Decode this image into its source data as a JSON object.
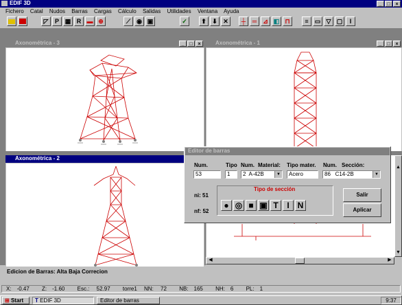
{
  "app": {
    "title": "EDIF 3D",
    "menu": [
      "Fichero",
      "Catal",
      "Nudos",
      "Barras",
      "Cargas",
      "Cálculo",
      "Salidas",
      "Utilidades",
      "Ventana",
      "Ayuda"
    ]
  },
  "toolbar": {
    "p_label": "P",
    "r_label": "R",
    "check_label": "✓"
  },
  "windows": {
    "view3": "Axonométrica - 3",
    "view1": "Axonométrica - 1",
    "view2": "Axonométrica - 2"
  },
  "dialog": {
    "title": "Editor de barras",
    "headers": {
      "num": "Num.",
      "tipo": "Tipo",
      "num2": "Num.",
      "material": "Material:",
      "tipo_mater": "Tipo mater.",
      "num3": "Num.",
      "seccion": "Sección:"
    },
    "values": {
      "num": "53",
      "tipo": "1",
      "material_num": "2",
      "material": "A-42B",
      "tipo_mater": "Acero",
      "seccion_num": "86",
      "seccion": "C14-2B"
    },
    "ni_label": "ni:",
    "ni_value": "51",
    "nf_label": "nf:",
    "nf_value": "52",
    "section_group": "Tipo de sección",
    "section_buttons": [
      "circle-solid",
      "circle-ring",
      "square-solid",
      "square-hollow",
      "t-section",
      "i-section",
      "n-section"
    ],
    "buttons": {
      "salir": "Salir",
      "aplicar": "Aplicar"
    }
  },
  "status": {
    "message": "Edicion de Barras: Alta Baja Correcion",
    "x_label": "X:",
    "x": "-0.47",
    "z_label": "Z:",
    "z": "-1.60",
    "esc_label": "Esc.:",
    "esc": "52.97",
    "model": "torre1",
    "nn_label": "NN:",
    "nn": "72",
    "nb_label": "NB:",
    "nb": "165",
    "nh_label": "NH:",
    "nh": "6",
    "pl_label": "PL:",
    "pl": "1"
  },
  "taskbar": {
    "start": "Start",
    "task1": "EDIF 3D",
    "task2": "Editor de barras",
    "clock": "9:37"
  },
  "colors": {
    "title_active": "#000080",
    "tower": "#cc0000"
  }
}
